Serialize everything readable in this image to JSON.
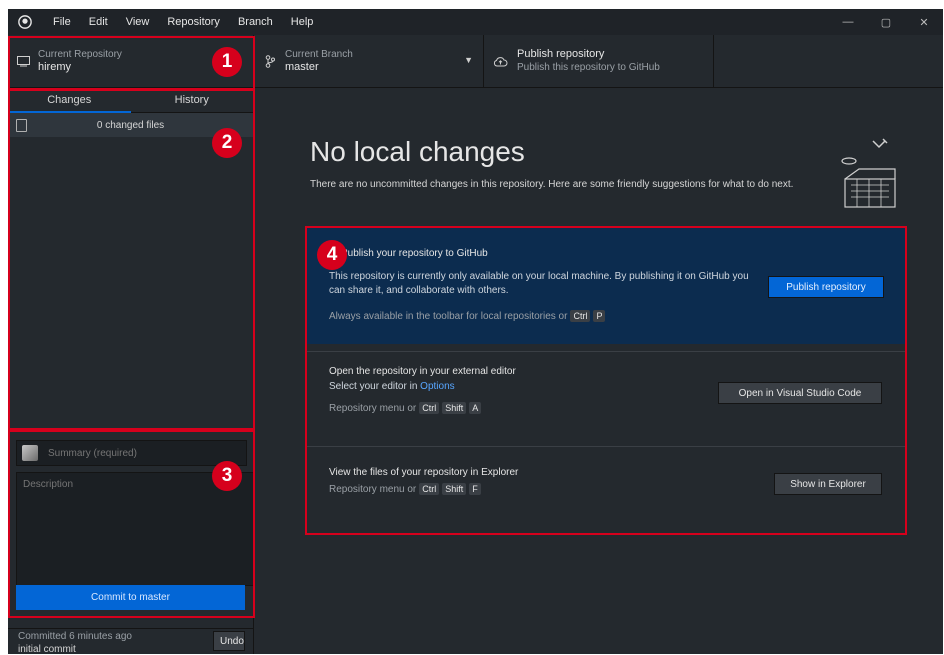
{
  "menu": [
    "File",
    "Edit",
    "View",
    "Repository",
    "Branch",
    "Help"
  ],
  "window_controls": [
    "—",
    "▢",
    "✕"
  ],
  "toolbar": {
    "current_repository_label": "Current Repository",
    "current_repository_value": "hiremy",
    "current_branch_label": "Current Branch",
    "current_branch_value": "master",
    "publish_label": "Publish repository",
    "publish_value": "Publish this repository to GitHub"
  },
  "left_panel": {
    "tabs": [
      "Changes",
      "History"
    ],
    "changed_files": "0 changed files",
    "summary_placeholder": "Summary (required)",
    "description_placeholder": "Description",
    "commit_button": "Commit to master",
    "committed_text": "Committed 6 minutes ago",
    "committed_message": "initial commit",
    "undo_button": "Undo"
  },
  "main": {
    "title": "No local changes",
    "subtitle": "There are no uncommitted changes in this repository. Here are some friendly suggestions for what to do next.",
    "cards": [
      {
        "title": "Publish your repository to GitHub",
        "description": "This repository is currently only available on your local machine. By publishing it on GitHub you can share it, and collaborate with others.",
        "hint": "Always available in the toolbar for local repositories or",
        "keys": [
          "Ctrl",
          "P"
        ],
        "button": "Publish repository"
      },
      {
        "title": "Open the repository in your external editor",
        "description_prefix": "Select your editor in",
        "description_link": "Options",
        "hint": "Repository menu or",
        "keys": [
          "Ctrl",
          "Shift",
          "A"
        ],
        "button": "Open in Visual Studio Code"
      },
      {
        "title": "View the files of your repository in Explorer",
        "hint": "Repository menu or",
        "keys": [
          "Ctrl",
          "Shift",
          "F"
        ],
        "button": "Show in Explorer"
      }
    ]
  },
  "annotations": [
    "1",
    "2",
    "3",
    "4"
  ],
  "colors": {
    "accent": "#0366d6",
    "annotation_red": "#d6001c",
    "background": "#24292e",
    "highlight_card": "#0c2c4f"
  },
  "icons": [
    "github-logo-icon",
    "computer-icon",
    "branch-icon",
    "cloud-upload-icon",
    "chevron-down-icon",
    "document-icon",
    "avatar-icon"
  ]
}
